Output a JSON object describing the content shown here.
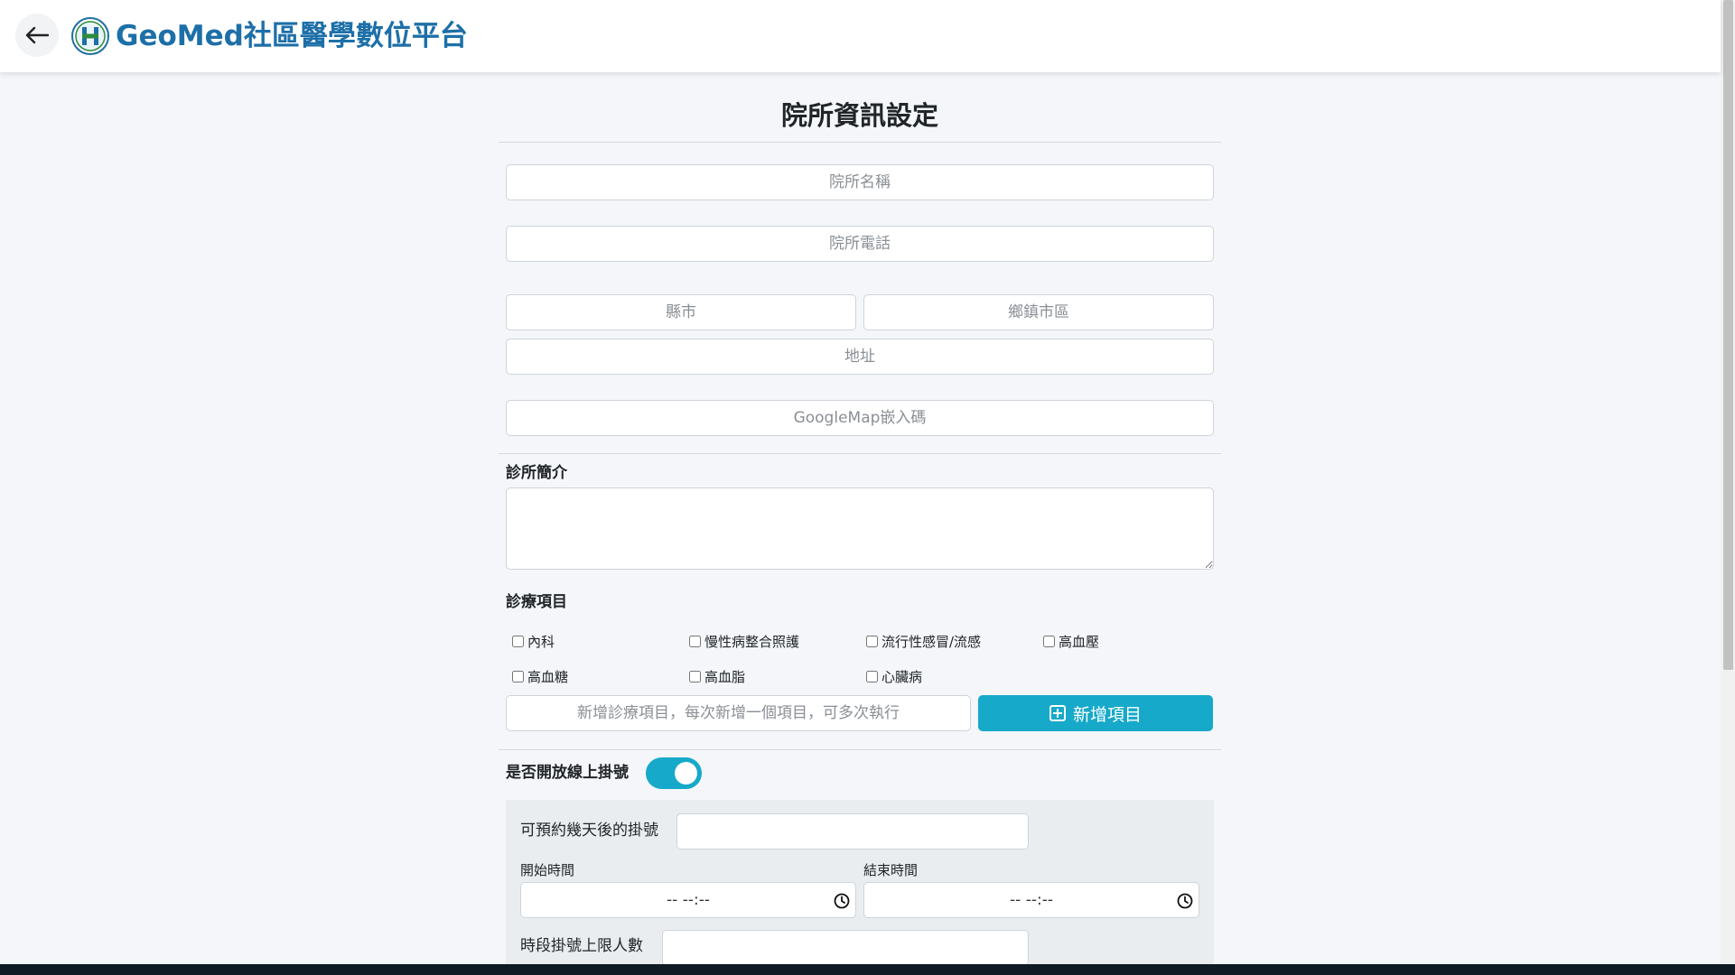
{
  "header": {
    "brand": "GeoMed社區醫學數位平台"
  },
  "form": {
    "title": "院所資訊設定",
    "clinic_name_placeholder": "院所名稱",
    "clinic_phone_placeholder": "院所電話",
    "county_placeholder": "縣市",
    "district_placeholder": "鄉鎮市區",
    "address_placeholder": "地址",
    "map_placeholder": "GoogleMap嵌入碼",
    "intro_label": "診所簡介",
    "services_label": "診療項目",
    "services": [
      "內科",
      "慢性病整合照護",
      "流行性感冒/流感",
      "高血壓",
      "高血糖",
      "高血脂",
      "心臟病"
    ],
    "new_service_placeholder": "新增診療項目，每次新增一個項目，可多次執行",
    "add_button_label": "新增項目",
    "online_booking_label": "是否開放線上掛號",
    "online_booking_enabled": true,
    "advance_days_label": "可預約幾天後的掛號",
    "start_time_label": "開始時間",
    "end_time_label": "結束時間",
    "time_empty_display": "-- --:--",
    "slot_limit_label": "時段掛號上限人數"
  },
  "colors": {
    "brand": "#1d6fa8",
    "accent": "#17a9c9"
  }
}
